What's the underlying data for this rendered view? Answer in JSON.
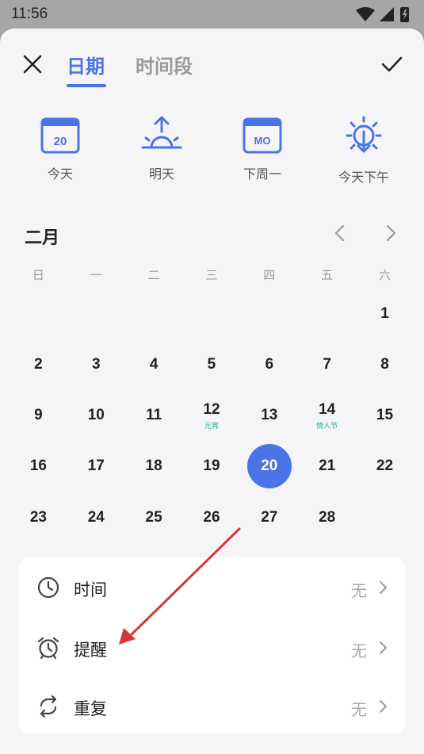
{
  "status_bar": {
    "time": "11:56"
  },
  "header": {
    "tabs": [
      {
        "label": "日期"
      },
      {
        "label": "时间段"
      }
    ]
  },
  "quick_options": [
    {
      "label": "今天",
      "icon": "calendar-today-icon",
      "icon_text": "20"
    },
    {
      "label": "明天",
      "icon": "sunrise-icon"
    },
    {
      "label": "下周一",
      "icon": "calendar-monday-icon",
      "icon_text": "MO"
    },
    {
      "label": "今天下午",
      "icon": "sun-afternoon-icon"
    }
  ],
  "calendar": {
    "month": "二月",
    "weekdays": [
      "日",
      "一",
      "二",
      "三",
      "四",
      "五",
      "六"
    ],
    "weeks": [
      [
        {
          "n": ""
        },
        {
          "n": ""
        },
        {
          "n": ""
        },
        {
          "n": ""
        },
        {
          "n": ""
        },
        {
          "n": ""
        },
        {
          "n": "1"
        }
      ],
      [
        {
          "n": "2"
        },
        {
          "n": "3"
        },
        {
          "n": "4"
        },
        {
          "n": "5"
        },
        {
          "n": "6"
        },
        {
          "n": "7"
        },
        {
          "n": "8"
        }
      ],
      [
        {
          "n": "9"
        },
        {
          "n": "10"
        },
        {
          "n": "11"
        },
        {
          "n": "12",
          "sub": "元宵"
        },
        {
          "n": "13"
        },
        {
          "n": "14",
          "sub": "情人节"
        },
        {
          "n": "15"
        }
      ],
      [
        {
          "n": "16"
        },
        {
          "n": "17"
        },
        {
          "n": "18"
        },
        {
          "n": "19"
        },
        {
          "n": "20",
          "selected": true
        },
        {
          "n": "21"
        },
        {
          "n": "22"
        }
      ],
      [
        {
          "n": "23"
        },
        {
          "n": "24"
        },
        {
          "n": "25"
        },
        {
          "n": "26"
        },
        {
          "n": "27"
        },
        {
          "n": "28"
        },
        {
          "n": ""
        }
      ]
    ]
  },
  "options": [
    {
      "label": "时间",
      "value": "无",
      "icon": "clock-icon"
    },
    {
      "label": "提醒",
      "value": "无",
      "icon": "alarm-clock-icon"
    },
    {
      "label": "重复",
      "value": "无",
      "icon": "repeat-icon"
    }
  ],
  "colors": {
    "accent": "#4a73e8",
    "festival": "#1fb28a",
    "annotation_arrow": "#d9383a"
  }
}
